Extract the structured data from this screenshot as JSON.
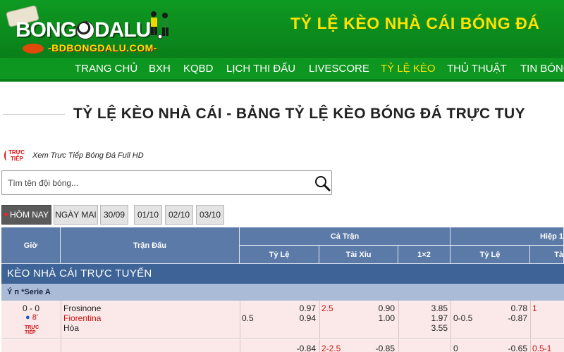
{
  "header": {
    "logo_bong": "BONG",
    "logo_dalu": "DALU",
    "logo_sub": "-BDBONGDALU.COM-",
    "title": "TỶ LỆ KÈO NHÀ CÁI BÓNG ĐÁ",
    "colors": {
      "green": "#0b8a1c",
      "yellow": "#ffe100"
    }
  },
  "nav": {
    "items": [
      {
        "label": "TRANG CHỦ"
      },
      {
        "label": "BXH"
      },
      {
        "label": "KQBD"
      },
      {
        "label": "LỊCH THI ĐẤU"
      },
      {
        "label": "LIVESCORE"
      },
      {
        "label": "TỶ LỆ KÈO"
      },
      {
        "label": "THỦ THUẬT"
      },
      {
        "label": "TIN BÓNG"
      }
    ],
    "active_index": 5
  },
  "page": {
    "title": "TỶ LỆ KÈO NHÀ CÁI - BẢNG TỶ LỆ KÈO BÓNG ĐÁ TRỰC TUY"
  },
  "live": {
    "badge_line1": "TRỰC",
    "badge_line2": "TIẾP",
    "link_text": "Xem Trực Tiếp Bóng Đá Full HD"
  },
  "search": {
    "placeholder": "Tìm tên đội bóng...",
    "value": ""
  },
  "date_tabs": [
    {
      "label": "HÔM NAY",
      "active": true
    },
    {
      "label": "NGÀY MAI",
      "active": false
    },
    {
      "label": "30/09",
      "active": false
    },
    {
      "label": "01/10",
      "active": false
    },
    {
      "label": "02/10",
      "active": false
    },
    {
      "label": "03/10",
      "active": false
    }
  ],
  "table": {
    "headers": {
      "time": "Giờ",
      "match": "Trận Đấu",
      "full_time": "Cả Trận",
      "half_time": "Hiệp 1",
      "handicap": "Tỷ Lệ",
      "over_under": "Tài Xỉu",
      "one_x_two": "1×2",
      "handicap_h1": "Tỷ Lệ",
      "over_under_h1": "Tà"
    },
    "section_title": "KÈO NHÀ CÁI TRỰC TUYẾN",
    "league": "Ý ᴨ *Serie A",
    "match": {
      "score": "0 - 0",
      "minute": "8'",
      "live_badge_1": "TRỰC",
      "live_badge_2": "TIẾP",
      "home": "Frosinone",
      "away": "Fiorentina",
      "draw": "Hòa",
      "hdp_line": "0.5",
      "hdp_home": "0.97",
      "hdp_away": "0.94",
      "ou_line": "2.5",
      "ou_over": "0.90",
      "ou_under": "1.00",
      "x12_home": "3.85",
      "x12_away": "1.97",
      "x12_draw": "3.55",
      "h1_hdp_line": "0-0.5",
      "h1_hdp_home": "0.78",
      "h1_hdp_away": "-0.87",
      "h1_ou_line": "1"
    },
    "match2": {
      "hdp_home": "-0.84",
      "ou_line": "2-2.5",
      "ou_over": "-0.85",
      "h1_hdp_line": "0",
      "h1_hdp_home": "-0.65",
      "h1_ou_line": "0.5-1"
    }
  }
}
